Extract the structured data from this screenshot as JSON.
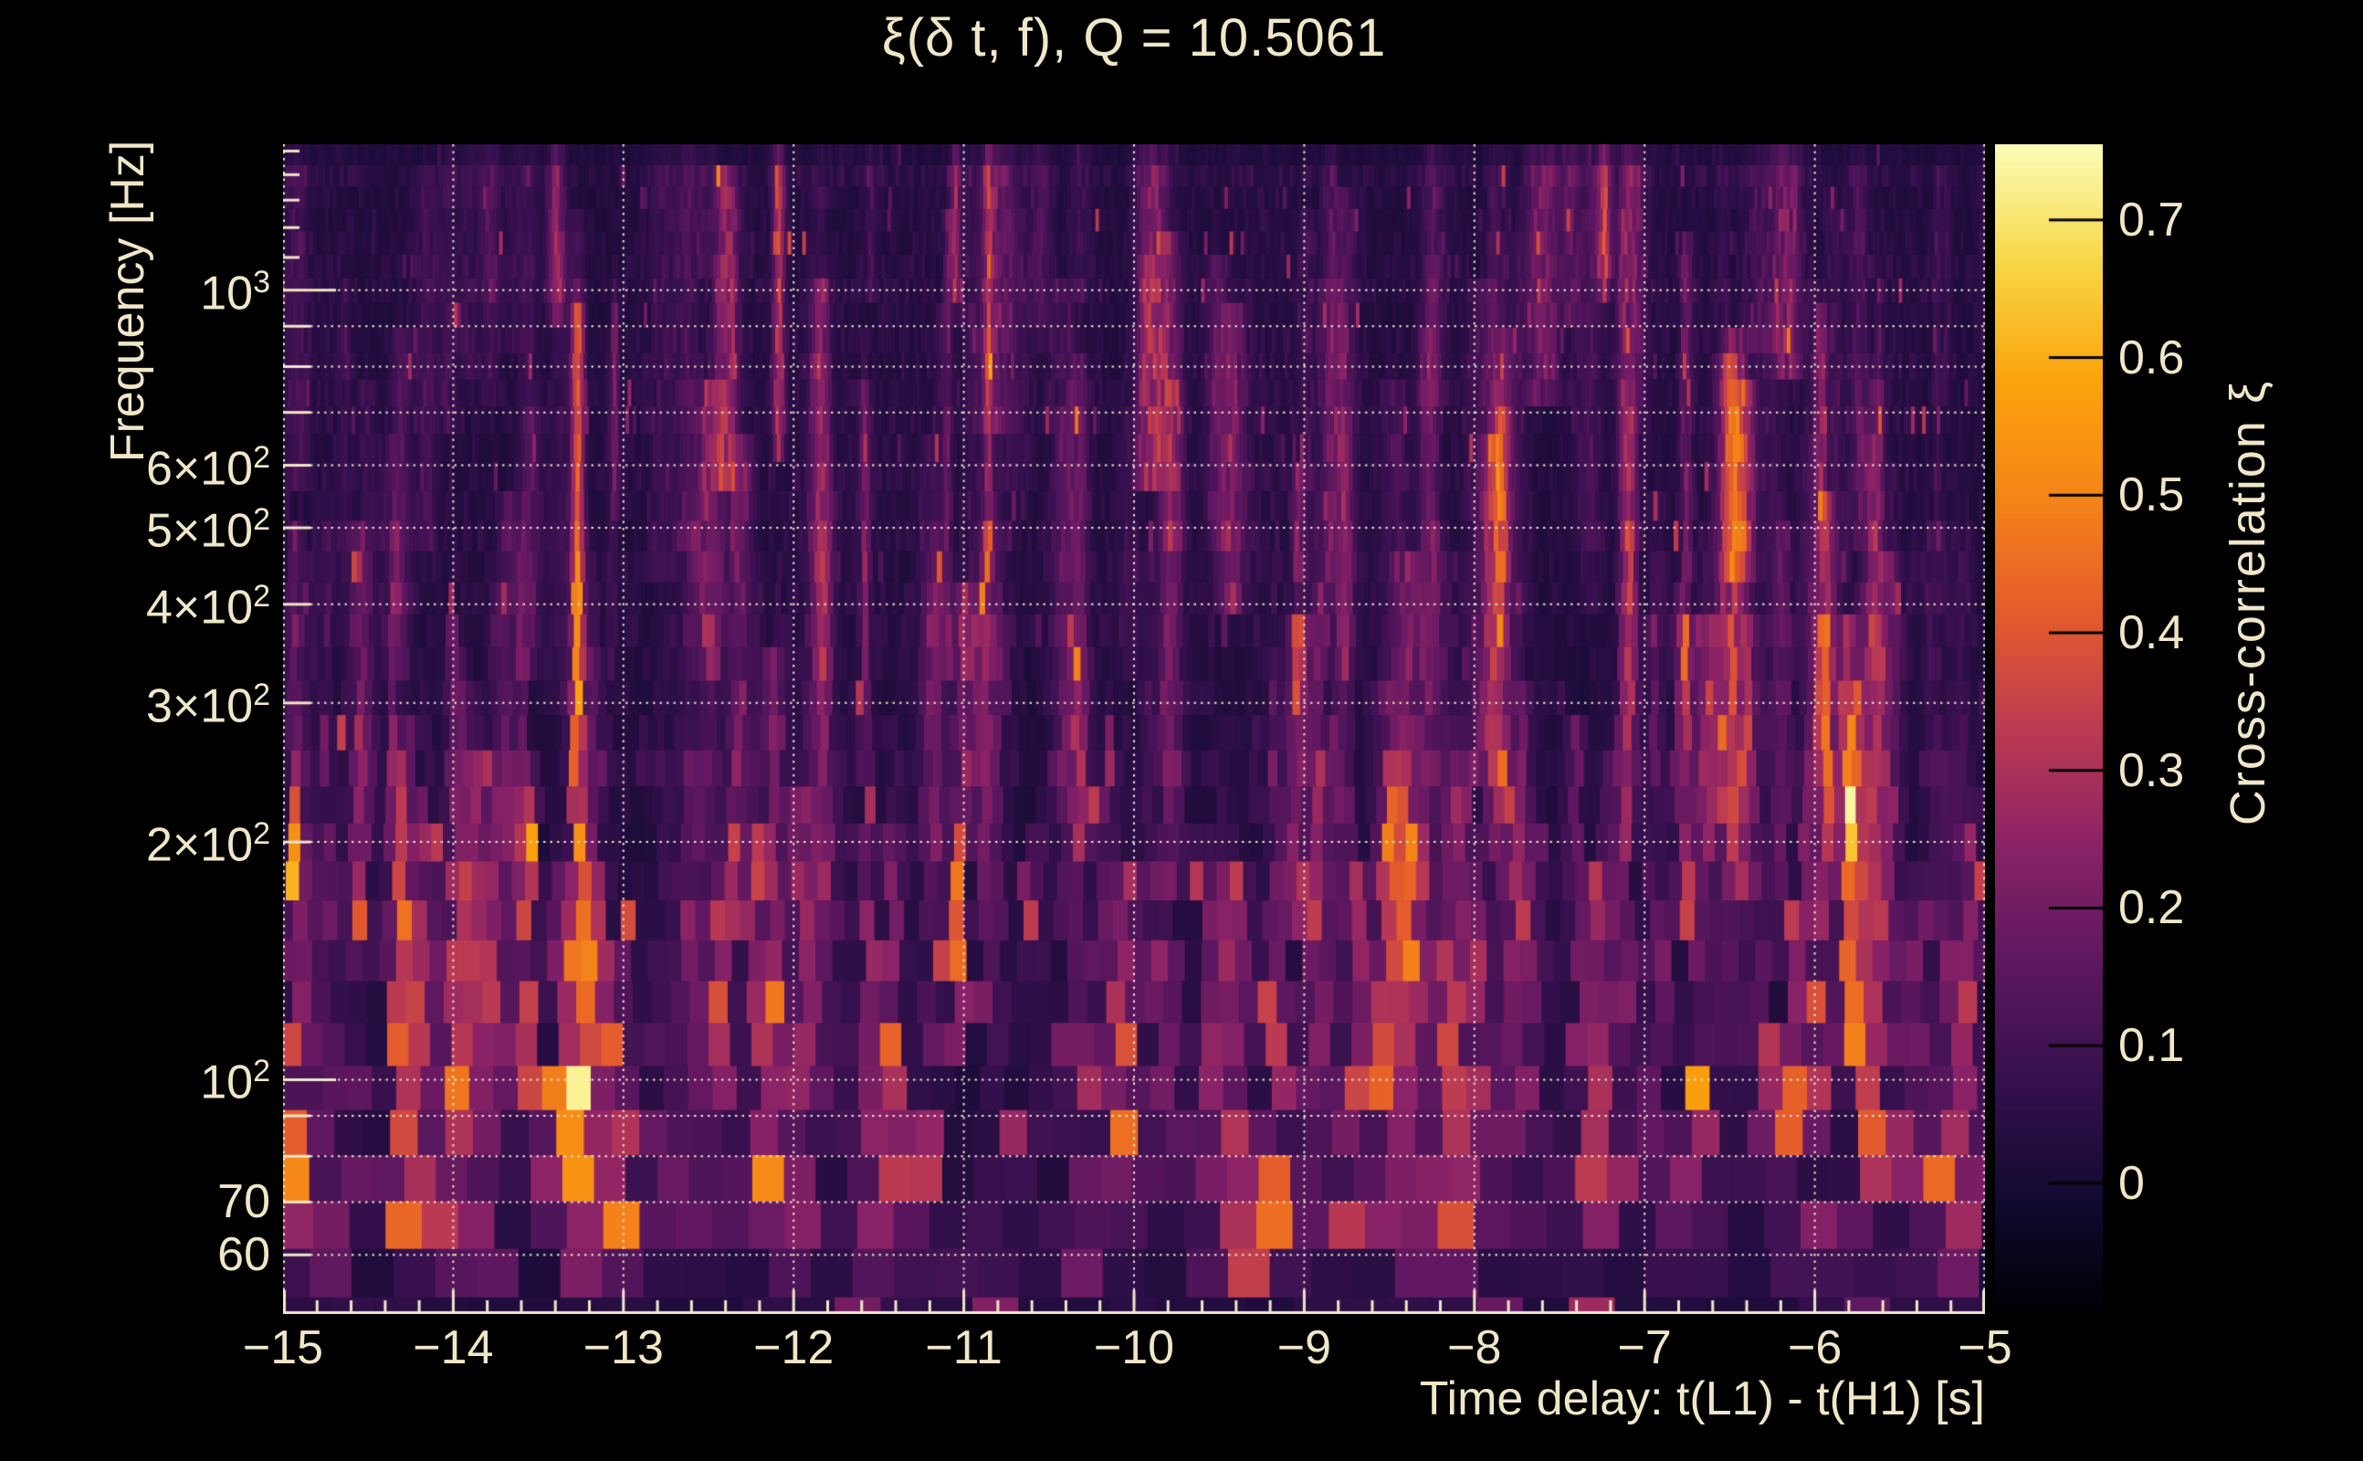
{
  "title": {
    "text": "ξ(δ t, f), Q = 10.5061"
  },
  "axes": {
    "x": {
      "label": "Time delay: t(L1) - t(H1) [s]",
      "min": -15,
      "max": -5,
      "major_ticks": [
        -15,
        -14,
        -13,
        -12,
        -11,
        -10,
        -9,
        -8,
        -7,
        -6,
        -5
      ],
      "tick_labels": [
        "−15",
        "−14",
        "−13",
        "−12",
        "−11",
        "−10",
        "−9",
        "−8",
        "−7",
        "−6",
        "−5"
      ],
      "minor_step": 0.2
    },
    "y": {
      "label": "Frequency [Hz]",
      "scale": "log",
      "min": 50.5,
      "max": 1530,
      "tick_labels": [
        {
          "base": "10",
          "exp": "3",
          "value": 1000
        },
        {
          "base": "6×10",
          "exp": "2",
          "value": 600
        },
        {
          "base": "5×10",
          "exp": "2",
          "value": 500
        },
        {
          "base": "4×10",
          "exp": "2",
          "value": 400
        },
        {
          "base": "3×10",
          "exp": "2",
          "value": 300
        },
        {
          "base": "2×10",
          "exp": "2",
          "value": 200
        },
        {
          "base": "10",
          "exp": "2",
          "value": 100
        },
        {
          "base": "70",
          "value": 70
        },
        {
          "base": "60",
          "value": 60
        }
      ],
      "gridline_values": [
        60,
        70,
        80,
        90,
        100,
        200,
        300,
        400,
        500,
        600,
        700,
        800,
        900,
        1000
      ],
      "long_tick_values": [
        100,
        1000
      ],
      "medium_tick_values": [
        60,
        70,
        80,
        90,
        200,
        300,
        400,
        500,
        600,
        700,
        800,
        900
      ],
      "short_tick_values": [
        1100,
        1200,
        1300,
        1400,
        1500
      ]
    },
    "colorbar": {
      "label": "Cross-correlation ξ",
      "min": -0.095,
      "max": 0.755,
      "tick_values": [
        0.7,
        0.6,
        0.5,
        0.4,
        0.3,
        0.2,
        0.1,
        0
      ],
      "tick_labels": [
        "0.7",
        "0.6",
        "0.5",
        "0.4",
        "0.3",
        "0.2",
        "0.1",
        "0"
      ],
      "colormap": "inferno"
    }
  },
  "colors": {
    "page_bg": "#000000",
    "text": "#f0e7c8",
    "grid_dots": "#f7f0da",
    "axis_tick": "#f0e7c8",
    "colorbar_tick": "#000000",
    "inferno_stops": [
      [
        0.0,
        "#000004"
      ],
      [
        0.1,
        "#120a32"
      ],
      [
        0.2,
        "#36104d"
      ],
      [
        0.3,
        "#5d175f"
      ],
      [
        0.4,
        "#8a2267"
      ],
      [
        0.5,
        "#bc3a52"
      ],
      [
        0.6,
        "#e55c2c"
      ],
      [
        0.7,
        "#f58518"
      ],
      [
        0.8,
        "#fba40d"
      ],
      [
        0.9,
        "#f7d747"
      ],
      [
        1.0,
        "#fcfdb8"
      ]
    ]
  },
  "chart_data": {
    "type": "heatmap",
    "title": "ξ(δ t, f), Q = 10.5061",
    "Q": 10.5061,
    "xlabel": "Time delay: t(L1) - t(H1) [s]",
    "ylabel": "Frequency [Hz]",
    "zlabel": "Cross-correlation ξ",
    "x_range_s": [
      -15,
      -5
    ],
    "y_range_hz": [
      50.5,
      1530
    ],
    "y_scale": "log",
    "z_range": [
      -0.095,
      0.755
    ],
    "background_level": 0.04,
    "grid": true,
    "legend_position": "right-colorbar",
    "noise_seed": 1234,
    "features": [
      {
        "t": -14.7,
        "f_lo": 53,
        "f_hi": 62,
        "xi": 0.32,
        "w_s": 0.05
      },
      {
        "t": -14.29,
        "f_lo": 63,
        "f_hi": 78,
        "xi": 0.38,
        "w_s": 0.05
      },
      {
        "t": -13.98,
        "f_lo": 55,
        "f_hi": 68,
        "xi": 0.28,
        "w_s": 0.04
      },
      {
        "t": -13.55,
        "f_lo": 78,
        "f_hi": 96,
        "xi": 0.4,
        "w_s": 0.05
      },
      {
        "t": -13.27,
        "f_lo": 52,
        "f_hi": 900,
        "xi": 0.42,
        "w_s": 0.03
      },
      {
        "t": -13.27,
        "f_lo": 60,
        "f_hi": 430,
        "xi": 0.56,
        "w_s": 0.03
      },
      {
        "t": -13.27,
        "f_lo": 86,
        "f_hi": 135,
        "xi": 0.75,
        "w_s": 0.034
      },
      {
        "t": -13.31,
        "f_lo": 58,
        "f_hi": 100,
        "xi": 0.5,
        "w_s": 0.07
      },
      {
        "t": -13.05,
        "f_lo": 560,
        "f_hi": 900,
        "xi": 0.24,
        "w_s": 0.018
      },
      {
        "t": -12.92,
        "f_lo": 52,
        "f_hi": 66,
        "xi": 0.36,
        "w_s": 0.04
      },
      {
        "t": -12.66,
        "f_lo": 55,
        "f_hi": 72,
        "xi": 0.32,
        "w_s": 0.05
      },
      {
        "t": -12.35,
        "f_lo": 160,
        "f_hi": 205,
        "xi": 0.33,
        "w_s": 0.025
      },
      {
        "t": -12.08,
        "f_lo": 55,
        "f_hi": 65,
        "xi": 0.3,
        "w_s": 0.04
      },
      {
        "t": -11.55,
        "f_lo": 160,
        "f_hi": 215,
        "xi": 0.36,
        "w_s": 0.025
      },
      {
        "t": -11.03,
        "f_lo": 120,
        "f_hi": 190,
        "xi": 0.46,
        "w_s": 0.028
      },
      {
        "t": -10.95,
        "f_lo": 60,
        "f_hi": 76,
        "xi": 0.3,
        "w_s": 0.04
      },
      {
        "t": -10.6,
        "f_lo": 108,
        "f_hi": 168,
        "xi": 0.32,
        "w_s": 0.025
      },
      {
        "t": -10.3,
        "f_lo": 50.5,
        "f_hi": 58,
        "xi": 0.36,
        "w_s": 0.05
      },
      {
        "t": -10.15,
        "f_lo": 170,
        "f_hi": 260,
        "xi": 0.27,
        "w_s": 0.025
      },
      {
        "t": -10.06,
        "f_lo": 83,
        "f_hi": 108,
        "xi": 0.46,
        "w_s": 0.035
      },
      {
        "t": -9.97,
        "f_lo": 58,
        "f_hi": 76,
        "xi": 0.32,
        "w_s": 0.04
      },
      {
        "t": -9.31,
        "f_lo": 50.5,
        "f_hi": 76,
        "xi": 0.58,
        "w_s": 0.04
      },
      {
        "t": -9.19,
        "f_lo": 60,
        "f_hi": 112,
        "xi": 0.46,
        "w_s": 0.032
      },
      {
        "t": -8.82,
        "f_lo": 190,
        "f_hi": 260,
        "xi": 0.3,
        "w_s": 0.025
      },
      {
        "t": -8.35,
        "f_lo": 72,
        "f_hi": 92,
        "xi": 0.36,
        "w_s": 0.03
      },
      {
        "t": -8.05,
        "f_lo": 140,
        "f_hi": 230,
        "xi": 0.27,
        "w_s": 0.025
      },
      {
        "t": -7.72,
        "f_lo": 103,
        "f_hi": 148,
        "xi": 0.5,
        "w_s": 0.03
      },
      {
        "t": -7.55,
        "f_lo": 64,
        "f_hi": 80,
        "xi": 0.32,
        "w_s": 0.035
      },
      {
        "t": -6.27,
        "f_lo": 70,
        "f_hi": 92,
        "xi": 0.4,
        "w_s": 0.03
      },
      {
        "t": -6.05,
        "f_lo": 140,
        "f_hi": 260,
        "xi": 0.25,
        "w_s": 0.025
      },
      {
        "t": -5.95,
        "f_lo": 54,
        "f_hi": 66,
        "xi": 0.32,
        "w_s": 0.045
      },
      {
        "t": -5.28,
        "f_lo": 58,
        "f_hi": 82,
        "xi": 0.5,
        "w_s": 0.035
      },
      {
        "t": -5.07,
        "f_lo": 88,
        "f_hi": 200,
        "xi": 0.32,
        "w_s": 0.025
      }
    ]
  }
}
